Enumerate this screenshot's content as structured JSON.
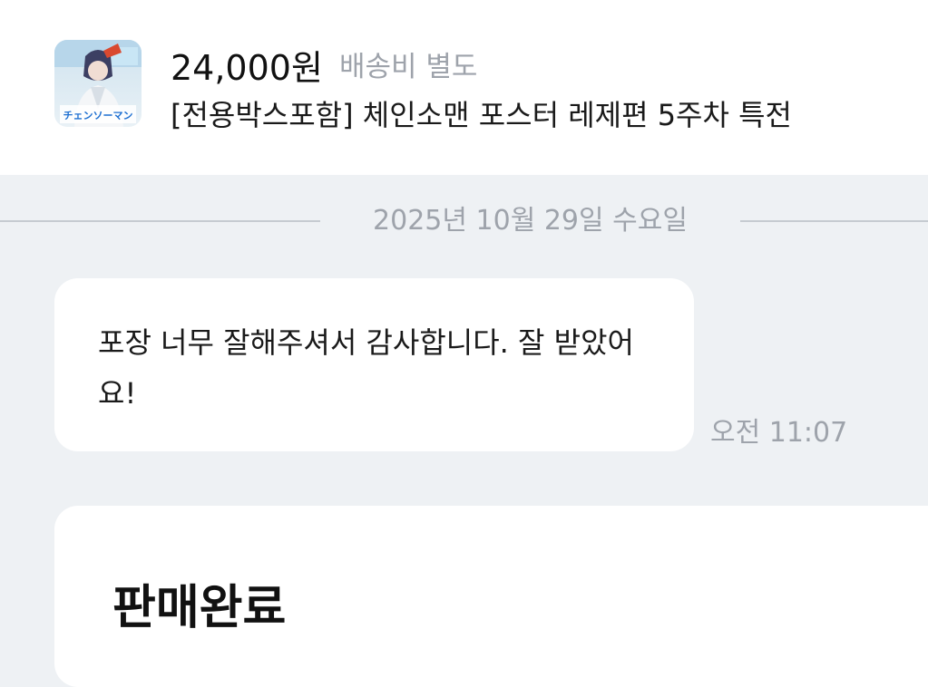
{
  "product": {
    "price": "24,000원",
    "shipping": "배송비 별도",
    "title": "[전용박스포함] 체인소맨 포스터 레제편 5주차 특전",
    "thumbnail_text": "チェンソーマン"
  },
  "date_divider": "2025년 10월 29일 수요일",
  "message": {
    "text": "포장 너무 잘해주셔서 감사합니다. 잘 받았어요!",
    "time": "오전 11:07"
  },
  "status_card": {
    "title": "판매완료"
  },
  "colors": {
    "chat_background": "#eef1f4",
    "secondary_text": "#9ea3ab",
    "divider": "#c6cbd1"
  }
}
